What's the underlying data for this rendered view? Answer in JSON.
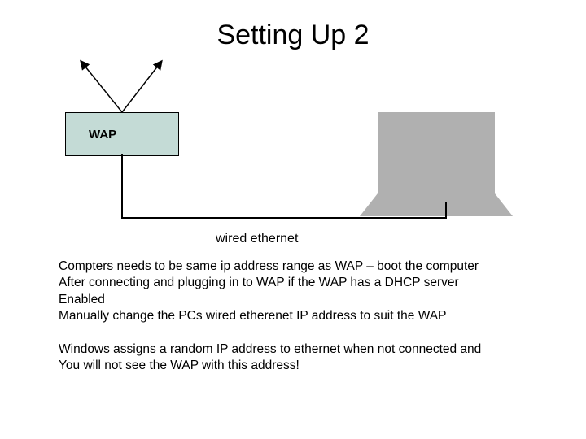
{
  "title": "Setting Up 2",
  "wap_label": "WAP",
  "cable_label": "wired ethernet",
  "para1_l1": "Compters needs to be same ip address range as WAP – boot the computer",
  "para1_l2": "After connecting and plugging in to WAP if the WAP has a DHCP server",
  "para1_l3": "Enabled",
  "para1_l4": "Manually change the PCs wired etherenet IP address to suit the WAP",
  "para2_l1": "Windows assigns a random IP address to ethernet when not connected and",
  "para2_l2": "You will not see the WAP with this address!",
  "colors": {
    "wap_fill": "#c4dbd6",
    "laptop_fill": "#b0b0b0"
  }
}
